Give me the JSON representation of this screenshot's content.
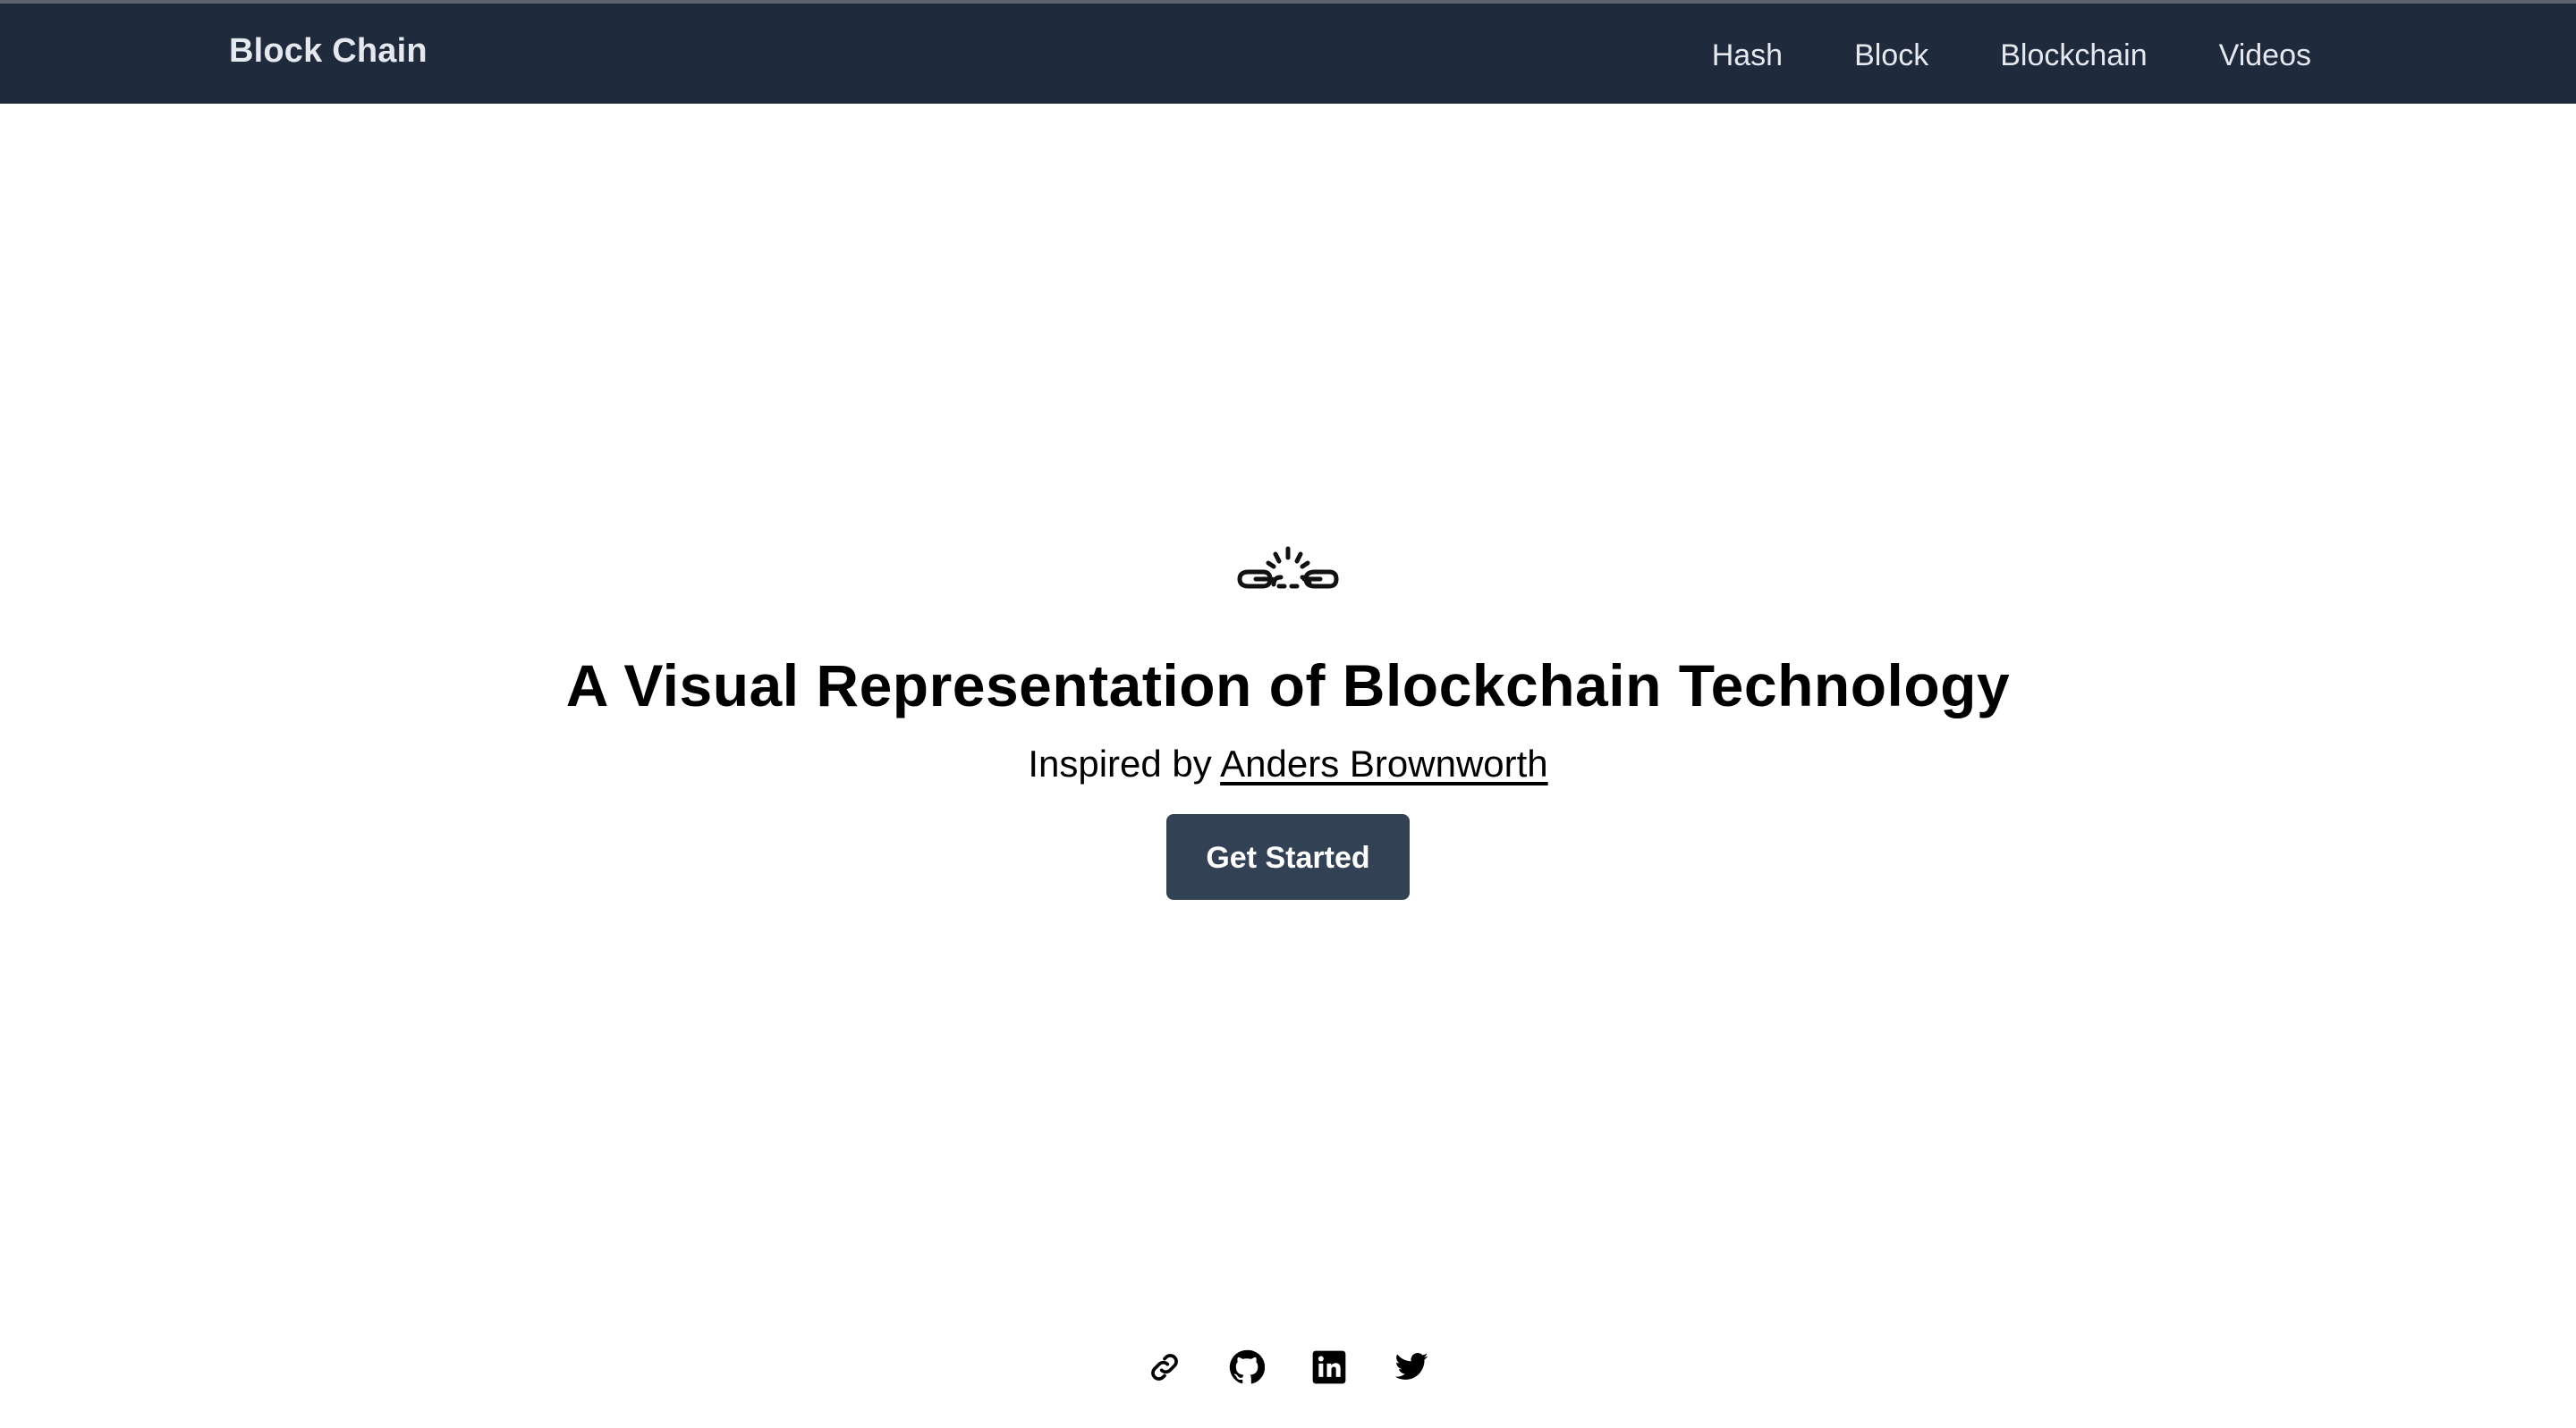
{
  "header": {
    "brand": "Block Chain",
    "nav": [
      {
        "label": "Hash"
      },
      {
        "label": "Block"
      },
      {
        "label": "Blockchain"
      },
      {
        "label": "Videos"
      }
    ]
  },
  "hero": {
    "icon": "broken-chain-icon",
    "title": "A Visual Representation of Blockchain Technology",
    "subtitle_prefix": "Inspired by",
    "subtitle_link": "Anders Brownworth",
    "cta_label": "Get Started"
  },
  "footer": {
    "icons": [
      "link-icon",
      "github-icon",
      "linkedin-icon",
      "twitter-icon"
    ]
  },
  "colors": {
    "header_bg": "#1f2a3c",
    "button_bg": "#334155",
    "text": "#000000",
    "nav_text": "#e5e8ee"
  }
}
